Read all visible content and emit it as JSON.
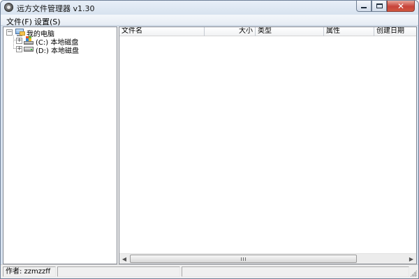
{
  "window": {
    "title": "远方文件管理器 v1.30",
    "buttons": {
      "minimize": "minimize-icon",
      "maximize": "maximize-icon",
      "close": "✕"
    }
  },
  "menu": [
    {
      "label": "文件(F)"
    },
    {
      "label": "设置(S)"
    }
  ],
  "tree": {
    "root": {
      "label": "我的电脑",
      "icon": "computer-icon",
      "expander": "−"
    },
    "children": [
      {
        "label": "(C:) 本地磁盘",
        "icon": "drive-c-icon",
        "expander": "+"
      },
      {
        "label": "(D:) 本地磁盘",
        "icon": "drive-d-icon",
        "expander": "+"
      }
    ]
  },
  "list": {
    "columns": [
      {
        "label": "文件名"
      },
      {
        "label": "大小"
      },
      {
        "label": "类型"
      },
      {
        "label": "属性"
      },
      {
        "label": "创建日期"
      }
    ],
    "rows": [],
    "scroll": {
      "left_arrow": "◀",
      "right_arrow": "▶",
      "position": 0
    }
  },
  "status": {
    "author": "作者: zzmzzff",
    "cell2": "",
    "cell3": ""
  }
}
